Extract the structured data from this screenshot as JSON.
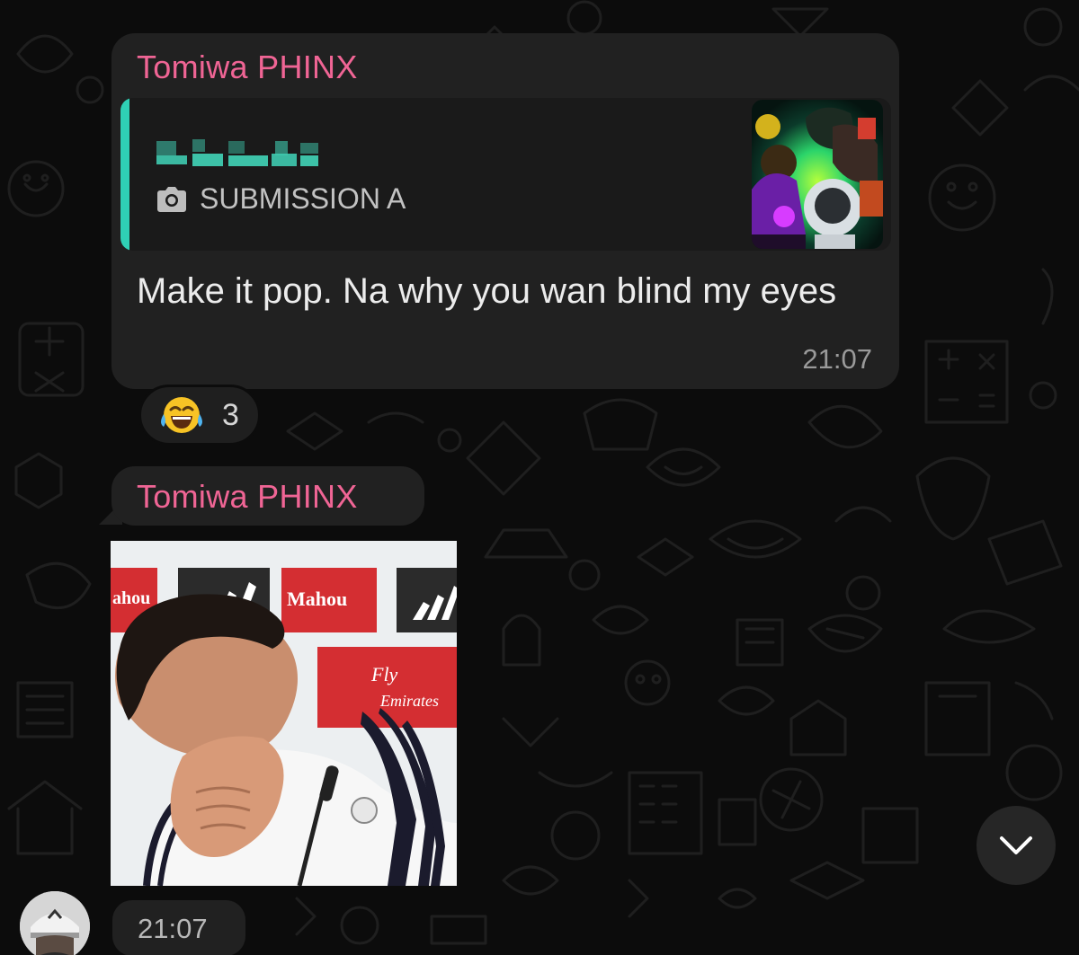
{
  "messages": [
    {
      "sender": "Tomiwa PHINX",
      "reply": {
        "author": "",
        "meta_icon": "camera-icon",
        "meta_label": "SUBMISSION A"
      },
      "text": "Make it pop. Na why you wan blind my eyes",
      "time": "21:07",
      "reaction": {
        "emoji": "😂",
        "count": "3"
      }
    },
    {
      "sender": "Tomiwa PHINX",
      "type": "image",
      "image_signs": {
        "sign1": "ahou",
        "sign2": "Mahou",
        "sign3": "adidas",
        "sponsor1": "Fly",
        "sponsor2": "Emirates"
      },
      "time": "21:07"
    }
  ],
  "scroll_button": {
    "icon": "chevron-down-icon"
  },
  "colors": {
    "sender": "#f06595",
    "reply_bar": "#2fd0b5",
    "bubble": "#212121",
    "background": "#0c0c0c"
  }
}
